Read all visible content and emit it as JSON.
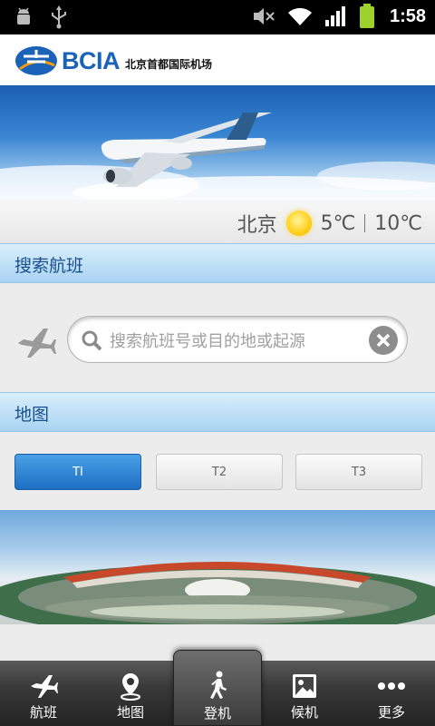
{
  "status_bar": {
    "time": "1:58",
    "icons": [
      "android-debug-icon",
      "usb-icon",
      "mute-icon",
      "wifi-icon",
      "signal-icon",
      "battery-icon"
    ]
  },
  "header": {
    "logo_text": "BCIA",
    "logo_subtitle": "北京首都国际机场"
  },
  "weather": {
    "city": "北京",
    "low": "5℃",
    "high": "10℃",
    "icon": "sun-icon"
  },
  "search_section": {
    "title": "搜索航班",
    "placeholder": "搜索航班号或目的地或起源"
  },
  "map_section": {
    "title": "地图",
    "terminals": [
      "TI",
      "T2",
      "T3"
    ],
    "selected": "TI"
  },
  "tabs": [
    {
      "label": "航班",
      "icon": "airplane-icon"
    },
    {
      "label": "地图",
      "icon": "map-pin-icon"
    },
    {
      "label": "登机",
      "icon": "walking-person-icon"
    },
    {
      "label": "候机",
      "icon": "gallery-icon"
    },
    {
      "label": "更多",
      "icon": "more-dots-icon"
    }
  ],
  "active_tab": "登机",
  "colors": {
    "brand_blue": "#1a63b8",
    "section_bar": "#bfe0f6",
    "active_button": "#1d6fc4",
    "tabbar": "#2e2e2e"
  }
}
